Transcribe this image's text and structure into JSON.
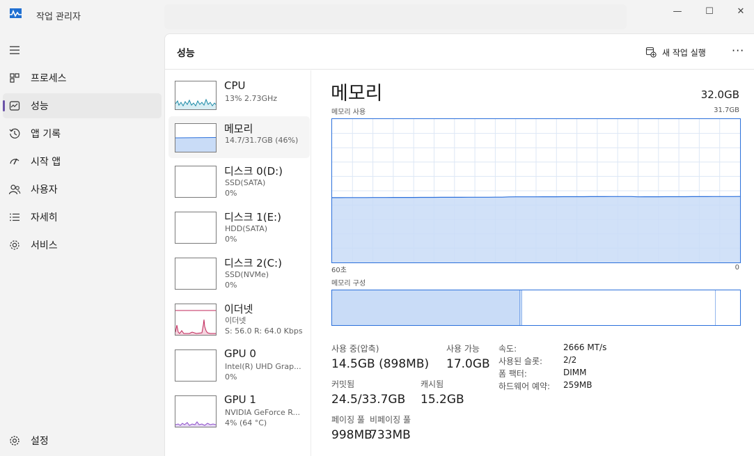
{
  "window": {
    "title": "작업 관리자",
    "controls": {
      "minimize": "—",
      "maximize": "☐",
      "close": "✕"
    }
  },
  "nav": {
    "menu_icon": "hamburger-icon",
    "items": [
      {
        "label": "프로세스",
        "icon": "processes-icon"
      },
      {
        "label": "성능",
        "icon": "performance-icon",
        "active": true
      },
      {
        "label": "앱 기록",
        "icon": "history-icon"
      },
      {
        "label": "시작 앱",
        "icon": "startup-icon"
      },
      {
        "label": "사용자",
        "icon": "users-icon"
      },
      {
        "label": "자세히",
        "icon": "details-icon"
      },
      {
        "label": "서비스",
        "icon": "services-icon"
      }
    ],
    "settings_label": "설정"
  },
  "header": {
    "title": "성능",
    "new_task_label": "새 작업 실행",
    "more_label": "···"
  },
  "resources": [
    {
      "name": "CPU",
      "sub1": "13% 2.73GHz",
      "sub2": ""
    },
    {
      "name": "메모리",
      "sub1": "14.7/31.7GB (46%)",
      "sub2": ""
    },
    {
      "name": "디스크 0(D:)",
      "sub1": "SSD(SATA)",
      "sub2": "0%"
    },
    {
      "name": "디스크 1(E:)",
      "sub1": "HDD(SATA)",
      "sub2": "0%"
    },
    {
      "name": "디스크 2(C:)",
      "sub1": "SSD(NVMe)",
      "sub2": "0%"
    },
    {
      "name": "이더넷",
      "sub1": "이더넷",
      "sub2": "S: 56.0  R: 64.0 Kbps"
    },
    {
      "name": "GPU 0",
      "sub1": "Intel(R) UHD Grap...",
      "sub2": "0%"
    },
    {
      "name": "GPU 1",
      "sub1": "NVIDIA GeForce R...",
      "sub2": "4% (64 °C)"
    }
  ],
  "detail": {
    "title": "메모리",
    "total": "32.0GB",
    "usage_label": "메모리 사용",
    "usage_max": "31.7GB",
    "axis_left": "60초",
    "axis_right": "0",
    "composition_label": "메모리 구성",
    "usage_fraction": 0.46,
    "composition": {
      "in_use": 0.46,
      "modified": 0.005,
      "standby": 0.475,
      "free": 0.06
    },
    "stats": {
      "in_use_label": "사용 중(압축)",
      "in_use_value": "14.5GB (898MB)",
      "available_label": "사용 가능",
      "available_value": "17.0GB",
      "committed_label": "커밋됨",
      "committed_value": "24.5/33.7GB",
      "cached_label": "캐시됨",
      "cached_value": "15.2GB",
      "paged_label": "페이징 풀",
      "paged_value": "998MB",
      "nonpaged_label": "비페이징 풀",
      "nonpaged_value": "733MB"
    },
    "specs": [
      {
        "k": "속도:",
        "v": "2666 MT/s"
      },
      {
        "k": "사용된 슬롯:",
        "v": "2/2"
      },
      {
        "k": "폼 팩터:",
        "v": "DIMM"
      },
      {
        "k": "하드웨어 예약:",
        "v": "259MB"
      }
    ]
  },
  "colors": {
    "memory_line": "#2a6fdb",
    "memory_fill": "#c9dcf7",
    "cpu_line": "#1c8aa6",
    "ethernet_line": "#c0275a",
    "gpu_line": "#8c4ec9",
    "accent": "#6b53a8"
  }
}
